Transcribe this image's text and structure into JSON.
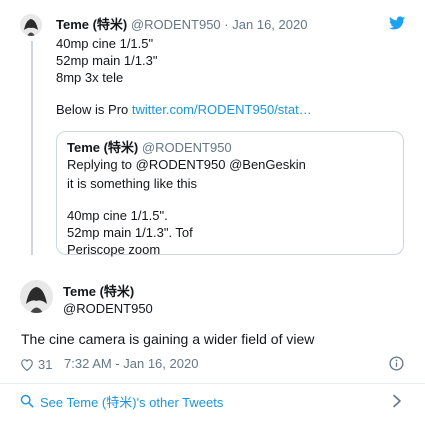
{
  "parent_tweet": {
    "author_name": "Teme (特米)",
    "handle": "@RODENT950",
    "separator": "·",
    "date": "Jan 16, 2020",
    "lines": [
      "40mp cine 1/1.5\"",
      "52mp main 1/1.3\"",
      "8mp 3x tele"
    ],
    "below_prefix": "Below is Pro",
    "link_text": "twitter.com/RODENT950/stat…",
    "bird_icon": "twitter-bird-icon"
  },
  "quoted_tweet": {
    "author_name": "Teme (特米)",
    "handle": "@RODENT950",
    "replying_label": "Replying to",
    "replying_to_1": "@RODENT950",
    "replying_to_2": "@BenGeskin",
    "lines": [
      "it is something like this",
      "40mp cine 1/1.5\".",
      "52mp main 1/1.3\". Tof",
      "Periscope zoom"
    ]
  },
  "main_tweet": {
    "author_name": "Teme (特米)",
    "handle": "@RODENT950",
    "text": "The cine camera is gaining a wider field of view",
    "like_count": "31",
    "timestamp": "7:32 AM - Jan 16, 2020"
  },
  "footer": {
    "label": "See Teme (特米)'s other Tweets"
  },
  "colors": {
    "accent": "#1da1f2",
    "like_red": "#e0245e",
    "link": "#1b95e0",
    "muted": "#657786",
    "line": "#ccd6dd"
  }
}
